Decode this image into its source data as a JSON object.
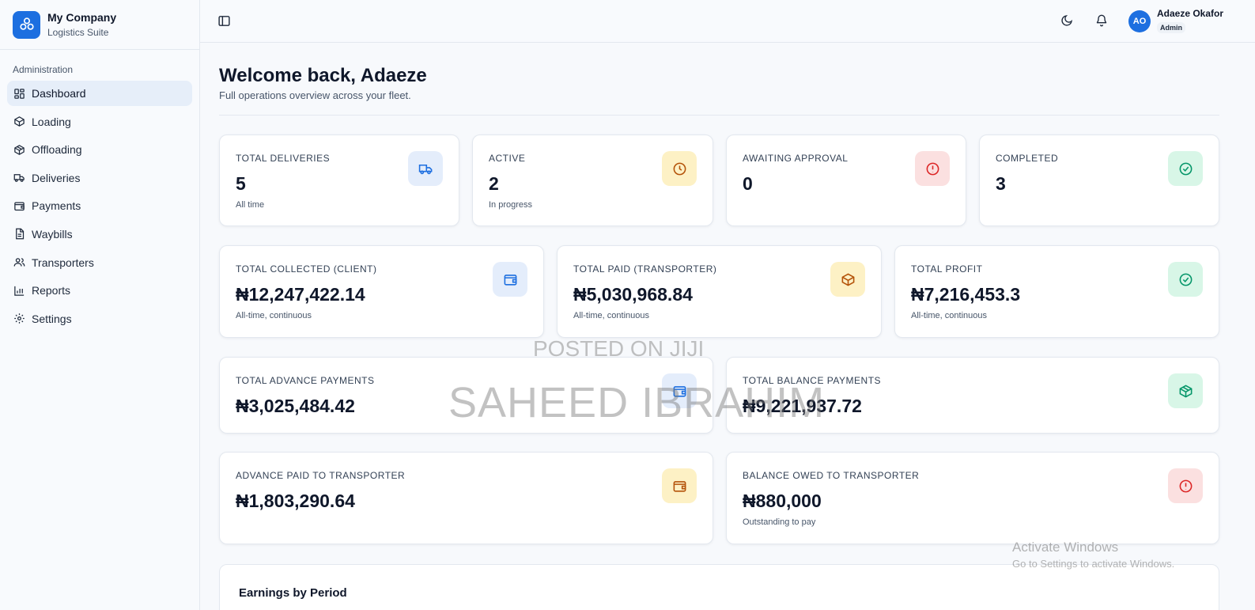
{
  "brand": {
    "name": "My Company",
    "subtitle": "Logistics Suite"
  },
  "sidebar": {
    "section_label": "Administration",
    "items": [
      {
        "label": "Dashboard",
        "icon": "dashboard-icon",
        "active": true
      },
      {
        "label": "Loading",
        "icon": "package-icon"
      },
      {
        "label": "Offloading",
        "icon": "box-icon"
      },
      {
        "label": "Deliveries",
        "icon": "truck-icon"
      },
      {
        "label": "Payments",
        "icon": "wallet-icon"
      },
      {
        "label": "Waybills",
        "icon": "document-icon"
      },
      {
        "label": "Transporters",
        "icon": "users-icon"
      },
      {
        "label": "Reports",
        "icon": "bar-chart-icon"
      },
      {
        "label": "Settings",
        "icon": "gear-icon"
      }
    ]
  },
  "header": {
    "user_initials": "AO",
    "user_name": "Adaeze Okafor",
    "user_role": "Admin"
  },
  "main": {
    "welcome": "Welcome back, Adaeze",
    "subtitle": "Full operations overview across your fleet.",
    "cards": {
      "total_deliveries": {
        "label": "TOTAL DELIVERIES",
        "value": "5",
        "sub": "All time",
        "icon": "truck-icon",
        "color": "#1d6fe0"
      },
      "active": {
        "label": "ACTIVE",
        "value": "2",
        "sub": "In progress",
        "icon": "clock-icon",
        "color": "#b45309"
      },
      "awaiting_approval": {
        "label": "AWAITING APPROVAL",
        "value": "0",
        "icon": "alert-circle-icon",
        "color": "#dc2626"
      },
      "completed": {
        "label": "COMPLETED",
        "value": "3",
        "icon": "check-circle-icon",
        "color": "#059669"
      },
      "total_collected": {
        "label": "TOTAL COLLECTED (CLIENT)",
        "value": "₦12,247,422.14",
        "sub": "All-time, continuous",
        "icon": "wallet-icon",
        "color": "#1d6fe0"
      },
      "total_paid": {
        "label": "TOTAL PAID (TRANSPORTER)",
        "value": "₦5,030,968.84",
        "sub": "All-time, continuous",
        "icon": "package-icon",
        "color": "#b45309"
      },
      "total_profit": {
        "label": "TOTAL PROFIT",
        "value": "₦7,216,453.3",
        "sub": "All-time, continuous",
        "icon": "check-circle-icon",
        "color": "#059669"
      },
      "total_advance": {
        "label": "TOTAL ADVANCE PAYMENTS",
        "value": "₦3,025,484.42",
        "icon": "wallet-icon",
        "color": "#1d6fe0"
      },
      "total_balance": {
        "label": "TOTAL BALANCE PAYMENTS",
        "value": "₦9,221,937.72",
        "icon": "box-icon",
        "color": "#059669"
      },
      "advance_paid": {
        "label": "ADVANCE PAID TO TRANSPORTER",
        "value": "₦1,803,290.64",
        "icon": "wallet-icon",
        "color": "#b45309"
      },
      "balance_owed": {
        "label": "BALANCE OWED TO TRANSPORTER",
        "value": "₦880,000",
        "sub": "Outstanding to pay",
        "icon": "alert-circle-icon",
        "color": "#dc2626"
      }
    },
    "earnings_title": "Earnings by Period"
  },
  "watermark": {
    "line1": "POSTED ON JIJI",
    "line2": "SAHEED IBRAHIM"
  },
  "os_overlay": {
    "title": "Activate Windows",
    "subtitle": "Go to Settings to activate Windows."
  }
}
